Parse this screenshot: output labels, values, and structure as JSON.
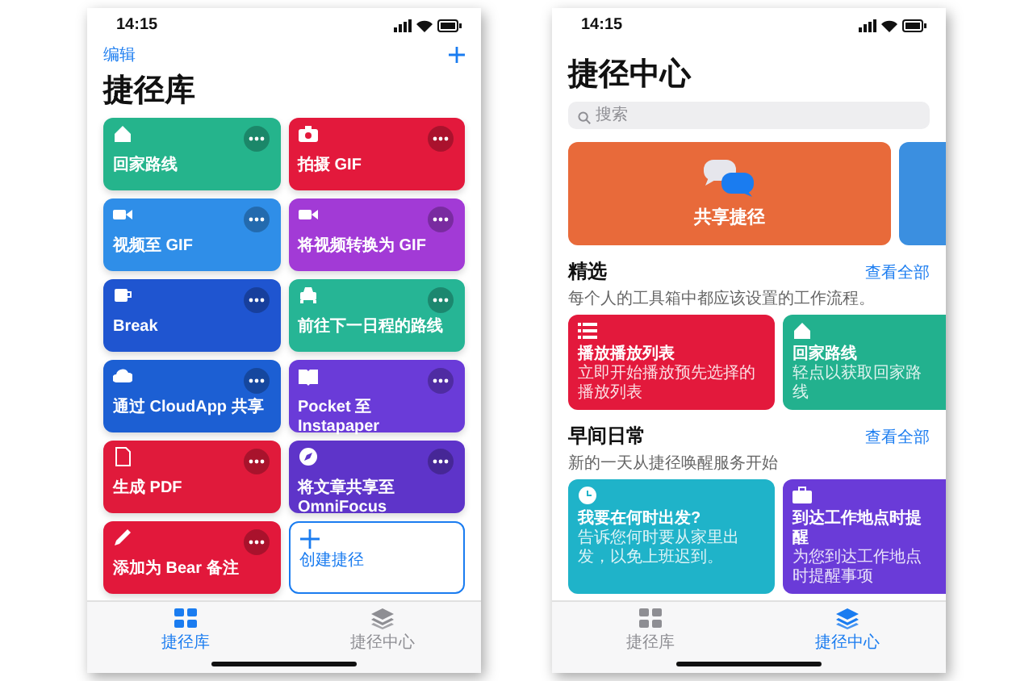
{
  "library": {
    "status_time": "14:15",
    "edit_link": "编辑",
    "title": "捷径库",
    "shortcuts": [
      {
        "kind": "shortcut",
        "label": "回家路线",
        "color": "#25b48c"
      },
      {
        "kind": "shortcut",
        "label": "拍摄 GIF",
        "color": "#e3193c"
      },
      {
        "kind": "shortcut",
        "label": "视频至 GIF",
        "color": "#2f8ee8"
      },
      {
        "kind": "shortcut",
        "label": "将视频转换为 GIF",
        "color": "#a23ad6"
      },
      {
        "kind": "shortcut",
        "label": "Break",
        "color": "#1f55d0"
      },
      {
        "kind": "shortcut",
        "label": "前往下一日程的路线",
        "color": "#26b595"
      },
      {
        "kind": "shortcut",
        "label": "通过 CloudApp 共享",
        "color": "#1c5fd3"
      },
      {
        "kind": "shortcut",
        "label": "Pocket 至 Instapaper",
        "color": "#6a3bd8"
      },
      {
        "kind": "shortcut",
        "label": "生成 PDF",
        "color": "#e01a3b"
      },
      {
        "kind": "shortcut",
        "label": "将文章共享至 OmniFocus",
        "color": "#5e34c9"
      },
      {
        "kind": "shortcut",
        "label": "添加为 Bear 备注",
        "color": "#e2183b"
      },
      {
        "kind": "create",
        "label": "创建捷径"
      }
    ],
    "tab_bar": [
      {
        "label": "捷径库",
        "selected": true
      },
      {
        "label": "捷径中心",
        "selected": false
      }
    ]
  },
  "gallery": {
    "status_time": "14:15",
    "title": "捷径中心",
    "search": {
      "placeholder": "搜索"
    },
    "hero": {
      "title": "共享捷径",
      "color": "#e86a3a"
    },
    "sections": [
      {
        "title": "精选",
        "see_all": "查看全部",
        "description": "每个人的工具箱中都应该设置的工作流程。",
        "cards": [
          {
            "title": "播放播放列表",
            "subtitle": "立即开始播放预先选择的播放列表",
            "color": "#e3193c"
          },
          {
            "title": "回家路线",
            "subtitle": "轻点以获取回家路线",
            "color": "#22b18e"
          }
        ]
      },
      {
        "title": "早间日常",
        "see_all": "查看全部",
        "description": "新的一天从捷径唤醒服务开始",
        "cards": [
          {
            "title": "我要在何时出发?",
            "subtitle": "告诉您何时要从家里出发，以免上班迟到。",
            "color": "#1fb3c9"
          },
          {
            "title": "到达工作地点时提醒",
            "subtitle": "为您到达工作地点时提醒事项",
            "color": "#6a3bd8"
          }
        ]
      }
    ],
    "tab_bar": [
      {
        "label": "捷径库",
        "selected": false
      },
      {
        "label": "捷径中心",
        "selected": true
      }
    ]
  }
}
